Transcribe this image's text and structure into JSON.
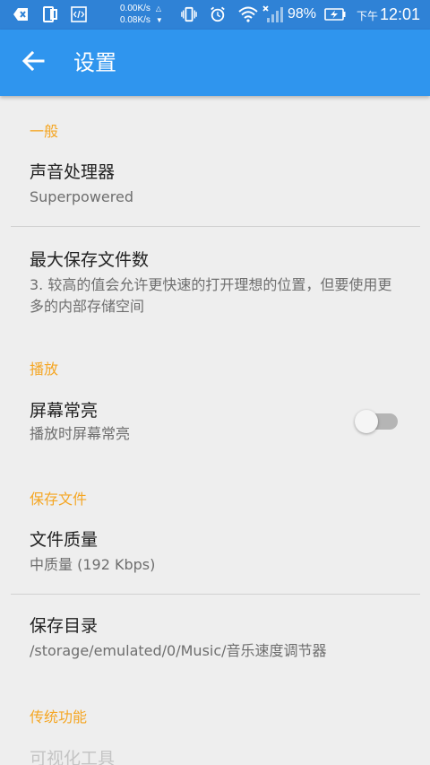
{
  "status_bar": {
    "net_up": "0.00K/s",
    "net_down": "0.08K/s",
    "battery_percent": "98%",
    "time_period": "下午",
    "time": "12:01",
    "icons": [
      "notification-icon",
      "phone-icon",
      "code-icon",
      "vibrate-icon",
      "alarm-icon",
      "wifi-icon",
      "signal-icon",
      "battery-charging-icon"
    ]
  },
  "app_bar": {
    "title": "设置",
    "back_icon": "back-arrow-icon"
  },
  "sections": {
    "general": {
      "header": "一般",
      "sound_processor": {
        "title": "声音处理器",
        "summary": "Superpowered"
      },
      "max_files": {
        "title": "最大保存文件数",
        "summary": "3. 较高的值会允许更快速的打开理想的位置，但要使用更多的内部存储空间"
      }
    },
    "playback": {
      "header": "播放",
      "screen_on": {
        "title": "屏幕常亮",
        "summary": "播放时屏幕常亮",
        "enabled": false
      }
    },
    "save_file": {
      "header": "保存文件",
      "quality": {
        "title": "文件质量",
        "summary": "中质量 (192 Kbps)"
      },
      "directory": {
        "title": "保存目录",
        "summary": "/storage/emulated/0/Music/音乐速度调节器"
      }
    },
    "legacy": {
      "header": "传统功能",
      "visualizer": {
        "title": "可视化工具"
      }
    }
  },
  "colors": {
    "status_bar": "#2f82d6",
    "app_bar": "#2f95ee",
    "section_header": "#f5a623",
    "background": "#eeeeee"
  }
}
